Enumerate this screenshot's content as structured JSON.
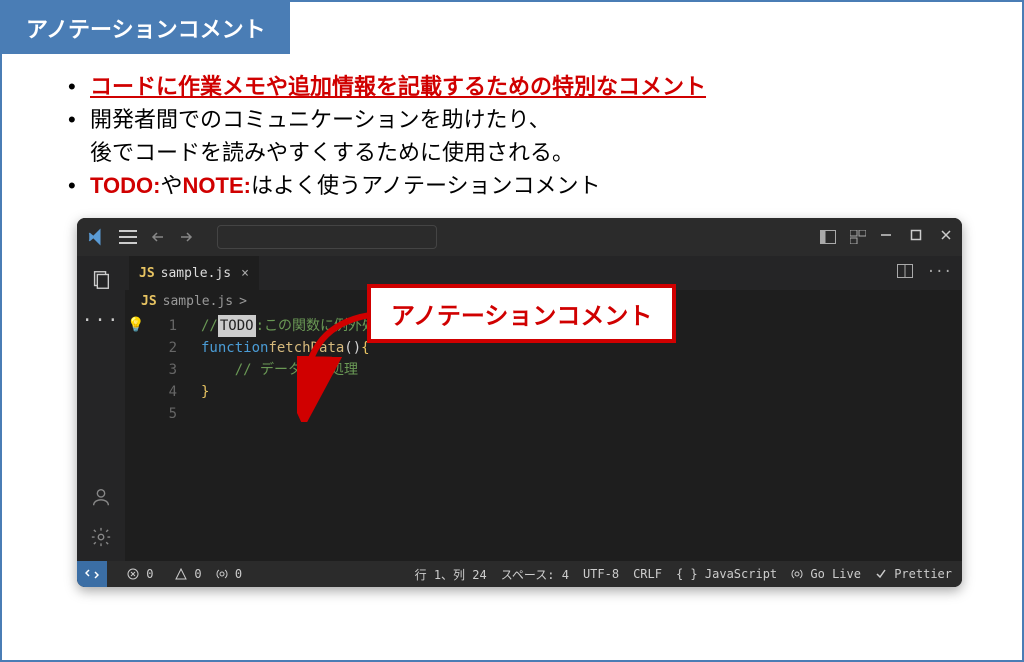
{
  "header": {
    "title": "アノテーションコメント"
  },
  "bullets": {
    "b1": "コードに作業メモや追加情報を記載するための特別なコメント",
    "b2a": "開発者間でのコミュニケーションを助けたり、",
    "b2b": "後でコードを読みやすくするために使用される。",
    "b3_todo": "TODO:",
    "b3_mid": "や",
    "b3_note": "NOTE:",
    "b3_tail": "はよく使うアノテーションコメント"
  },
  "callout": {
    "label": "アノテーションコメント"
  },
  "vscode": {
    "tab_prefix": "JS",
    "tab_name": "sample.js",
    "breadcrumb_prefix": "JS",
    "breadcrumb_name": "sample.js",
    "breadcrumb_sep": ">",
    "code": {
      "l1_slash": "// ",
      "l1_todo": "TODO",
      "l1_colon": ":",
      "l1_rest": " この関数に例外処理を追加する",
      "l2_kw": "function",
      "l2_sp": " ",
      "l2_fn": "fetchData",
      "l2_paren": "()",
      "l2_sp2": " ",
      "l2_brace": "{",
      "l3_indent": "    ",
      "l3_comment": "// データ取得処理",
      "l4_brace": "}",
      "ln1": "1",
      "ln2": "2",
      "ln3": "3",
      "ln4": "4",
      "ln5": "5"
    },
    "status": {
      "errors": "0",
      "warnings": "0",
      "radio": "0",
      "pos": "行 1、列 24",
      "spaces": "スペース: 4",
      "enc": "UTF-8",
      "eol": "CRLF",
      "lang_braces": "{ }",
      "lang": "JavaScript",
      "golive": "Go Live",
      "prettier": "Prettier"
    }
  }
}
